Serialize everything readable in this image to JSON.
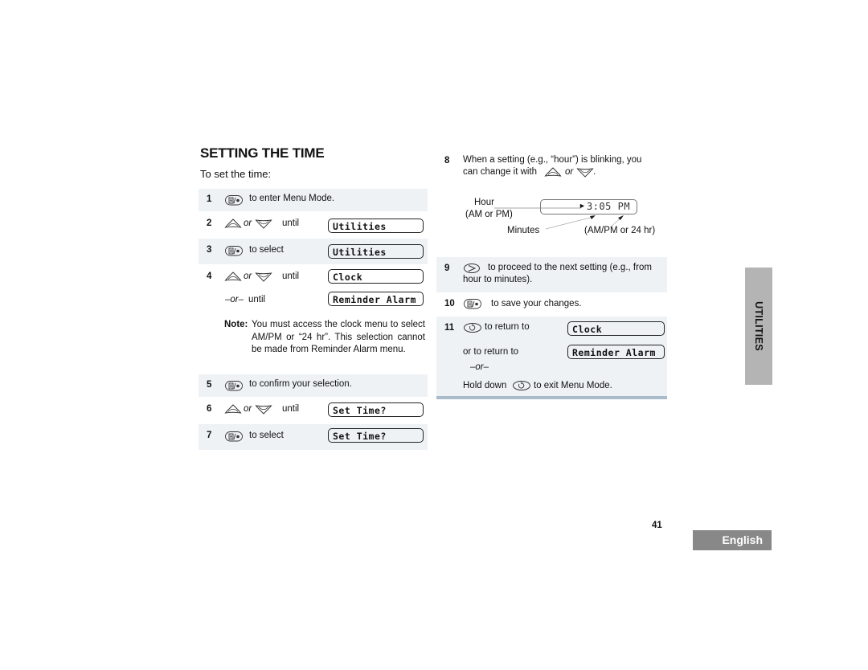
{
  "page": {
    "title": "SETTING THE TIME",
    "subtitle": "To set the time:",
    "page_number": "41",
    "side_tab": "UTILITIES",
    "language_tab": "English"
  },
  "icons": {
    "menu": "menu-select-key-icon",
    "up": "scroll-up-key-icon",
    "down": "scroll-down-key-icon",
    "right": "right-arrow-key-icon",
    "back": "back-exit-key-icon"
  },
  "or_word": "or",
  "steps": [
    {
      "num": "1",
      "text": "to enter Menu Mode."
    },
    {
      "num": "2",
      "text": "until",
      "display": "Utilities"
    },
    {
      "num": "3",
      "text": "to select",
      "display": "Utilities"
    },
    {
      "num": "4",
      "text": "until",
      "display": "Clock",
      "alt_prefix": "–or–",
      "alt_text": "until",
      "alt_display": "Reminder Alarm"
    },
    {
      "num": "5",
      "text": "to confirm your selection."
    },
    {
      "num": "6",
      "text": "until",
      "display": "Set Time?"
    },
    {
      "num": "7",
      "text": "to select",
      "display": "Set Time?"
    },
    {
      "num": "8",
      "text_line1": "When a setting (e.g., “hour”) is blinking, you",
      "text_line2": "can change it with",
      "text_end": "."
    },
    {
      "num": "9",
      "text_line1": "to proceed to the next setting (e.g., from",
      "text_line2": "hour to minutes)."
    },
    {
      "num": "10",
      "text": "to save your changes."
    },
    {
      "num": "11",
      "text": "to return to",
      "display": "Clock",
      "alt_text": "or to return to",
      "alt_display": "Reminder Alarm",
      "or_line": "–or–",
      "hold_prefix": "Hold down",
      "hold_suffix": "to exit Menu Mode."
    }
  ],
  "note": {
    "label": "Note:",
    "body": "You must access the clock menu to select AM/PM or “24 hr”. This selection cannot be made from Reminder Alarm menu."
  },
  "clock_diagram": {
    "display": "3:05 PM",
    "label_hour": "Hour",
    "label_hour_sub": "(AM or PM)",
    "label_minutes": "Minutes",
    "label_ampm": "(AM/PM or 24 hr)"
  }
}
